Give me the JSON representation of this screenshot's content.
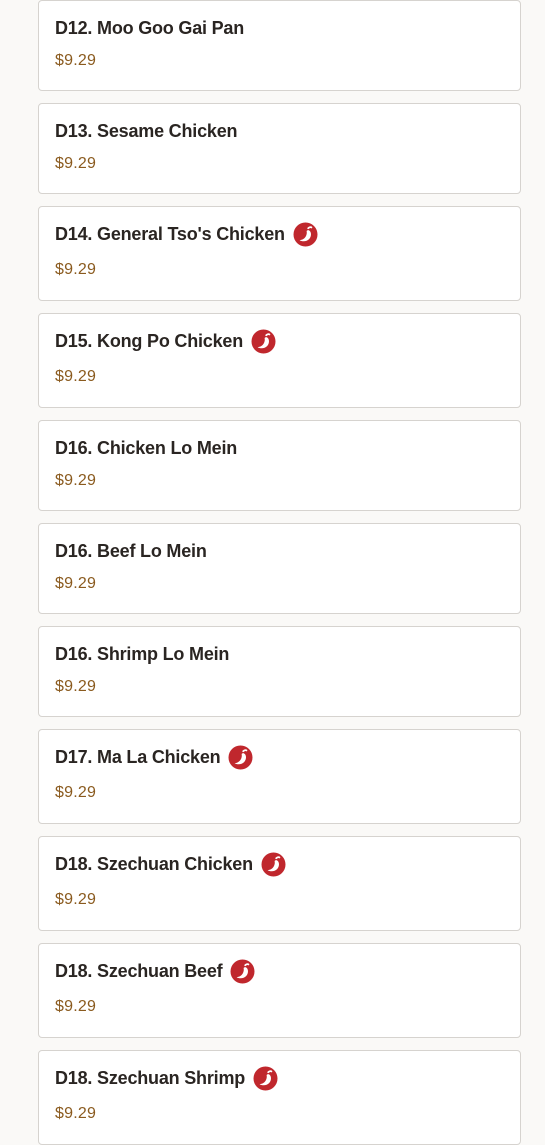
{
  "colors": {
    "price": "#8a5a1e",
    "spicy": "#c0272d",
    "border": "#d6d3cf",
    "background": "#faf9f7"
  },
  "menu_items": [
    {
      "name": "D12. Moo Goo Gai Pan",
      "price": "$9.29",
      "spicy": false
    },
    {
      "name": "D13. Sesame Chicken",
      "price": "$9.29",
      "spicy": false
    },
    {
      "name": "D14. General Tso's Chicken",
      "price": "$9.29",
      "spicy": true
    },
    {
      "name": "D15. Kong Po Chicken",
      "price": "$9.29",
      "spicy": true
    },
    {
      "name": "D16. Chicken Lo Mein",
      "price": "$9.29",
      "spicy": false
    },
    {
      "name": "D16. Beef Lo Mein",
      "price": "$9.29",
      "spicy": false
    },
    {
      "name": "D16. Shrimp Lo Mein",
      "price": "$9.29",
      "spicy": false
    },
    {
      "name": "D17. Ma La Chicken",
      "price": "$9.29",
      "spicy": true
    },
    {
      "name": "D18. Szechuan Chicken",
      "price": "$9.29",
      "spicy": true
    },
    {
      "name": "D18. Szechuan Beef",
      "price": "$9.29",
      "spicy": true
    },
    {
      "name": "D18. Szechuan Shrimp",
      "price": "$9.29",
      "spicy": true
    }
  ]
}
